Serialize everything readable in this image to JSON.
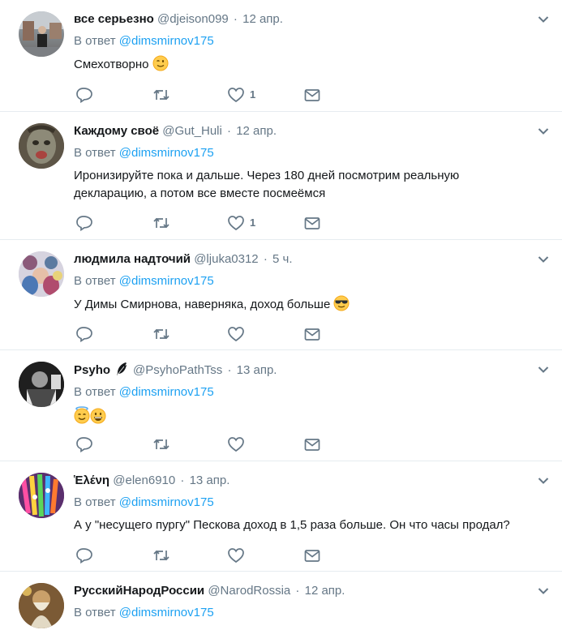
{
  "reply_prefix": "В ответ",
  "tweets": [
    {
      "name": "все серьезно",
      "handle": "@djeison099",
      "time": "12 апр.",
      "reply_to": "@dimsmirnov175",
      "text": "Смехотворно",
      "likes": "1"
    },
    {
      "name": "Каждому своё",
      "handle": "@Gut_Huli",
      "time": "12 апр.",
      "reply_to": "@dimsmirnov175",
      "text": "Иронизируйте пока и дальше.  Через 180 дней посмотрим реальную декларацию, а потом все  вместе посмеёмся",
      "likes": "1"
    },
    {
      "name": "людмила надточий",
      "handle": "@ljuka0312",
      "time": "5 ч.",
      "reply_to": "@dimsmirnov175",
      "text": "У Димы Смирнова, наверняка, доход больше",
      "likes": ""
    },
    {
      "name": "Psyho",
      "handle": "@PsyhoPathTss",
      "time": "13 апр.",
      "reply_to": "@dimsmirnov175",
      "text": "",
      "likes": ""
    },
    {
      "name": "Ἑλένη",
      "handle": "@elen6910",
      "time": "13 апр.",
      "reply_to": "@dimsmirnov175",
      "text": "А у \"несущего пургу\" Пескова доход в 1,5 раза больше. Он что часы продал?",
      "likes": ""
    },
    {
      "name": "РусскийНародРоссии",
      "handle": "@NarodRossia",
      "time": "12 апр.",
      "reply_to": "@dimsmirnov175",
      "text": "",
      "likes": ""
    }
  ],
  "colors": {
    "link": "#1da1f2",
    "muted": "#657786",
    "border": "#e6ecf0"
  }
}
